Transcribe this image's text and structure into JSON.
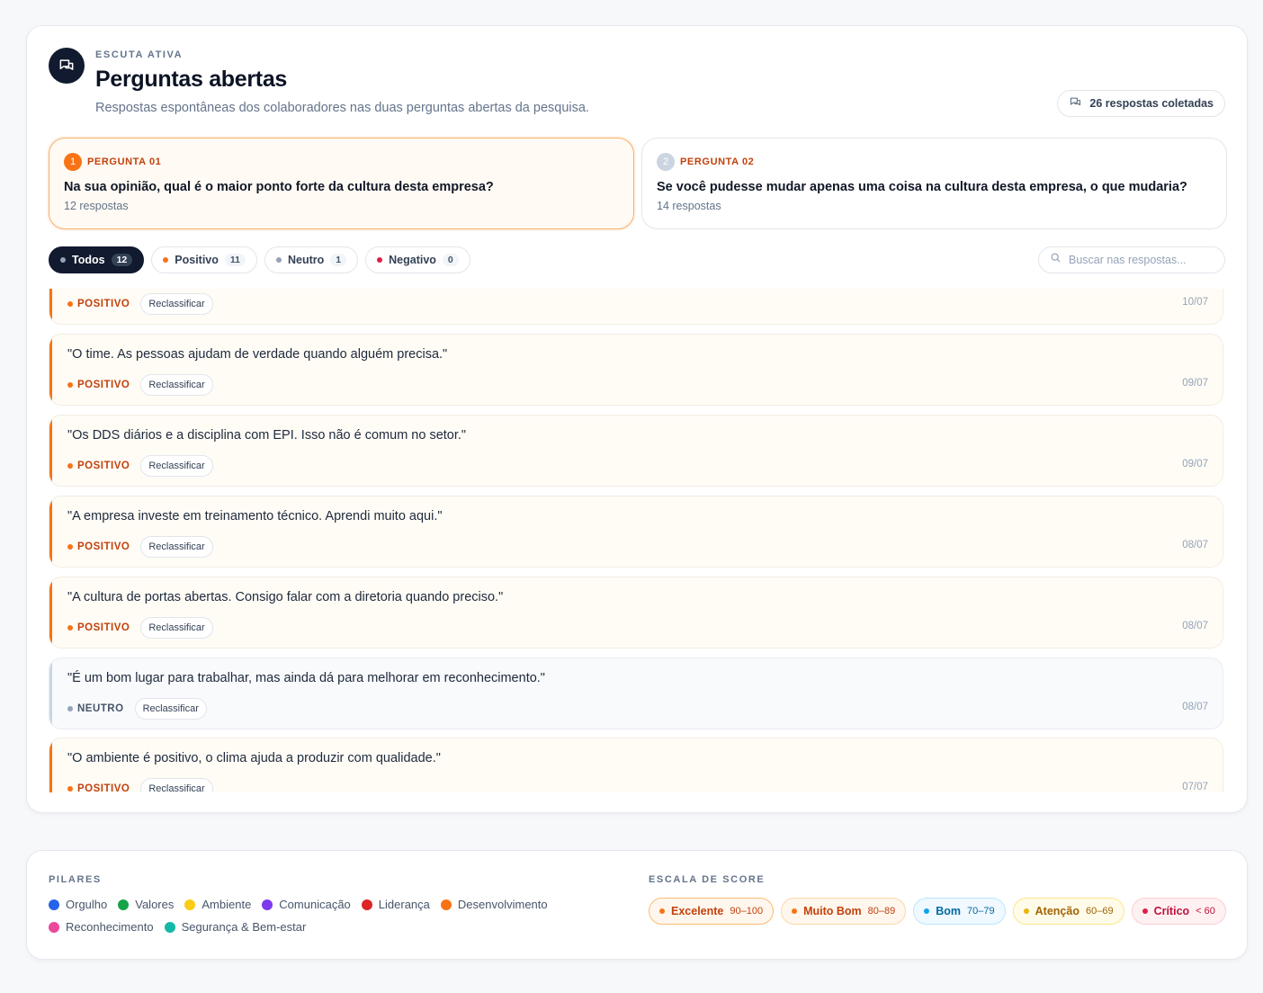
{
  "header": {
    "eyebrow": "ESCUTA ATIVA",
    "title": "Perguntas abertas",
    "subtitle": "Respostas espontâneas dos colaboradores nas duas perguntas abertas da pesquisa.",
    "responses_count": "26 respostas coletadas"
  },
  "questions": [
    {
      "num": "1",
      "label": "PERGUNTA 01",
      "text": "Na sua opinião, qual é o maior ponto forte da cultura desta empresa?",
      "count": "12 respostas"
    },
    {
      "num": "2",
      "label": "PERGUNTA 02",
      "text": "Se você pudesse mudar apenas uma coisa na cultura desta empresa, o que mudaria?",
      "count": "14 respostas"
    }
  ],
  "filters": [
    {
      "label": "Todos",
      "count": "12",
      "color": "#94a3b8"
    },
    {
      "label": "Positivo",
      "count": "11",
      "color": "#f97316"
    },
    {
      "label": "Neutro",
      "count": "1",
      "color": "#94a3b8"
    },
    {
      "label": "Negativo",
      "count": "0",
      "color": "#e11d48"
    }
  ],
  "search": {
    "placeholder": "Buscar nas respostas..."
  },
  "reclassify_label": "Reclassificar",
  "responses": [
    {
      "text": "",
      "sentiment": "POSITIVO",
      "date": "10/07"
    },
    {
      "text": "\"O time. As pessoas ajudam de verdade quando alguém precisa.\"",
      "sentiment": "POSITIVO",
      "date": "09/07"
    },
    {
      "text": "\"Os DDS diários e a disciplina com EPI. Isso não é comum no setor.\"",
      "sentiment": "POSITIVO",
      "date": "09/07"
    },
    {
      "text": "\"A empresa investe em treinamento técnico. Aprendi muito aqui.\"",
      "sentiment": "POSITIVO",
      "date": "08/07"
    },
    {
      "text": "\"A cultura de portas abertas. Consigo falar com a diretoria quando preciso.\"",
      "sentiment": "POSITIVO",
      "date": "08/07"
    },
    {
      "text": "\"É um bom lugar para trabalhar, mas ainda dá para melhorar em reconhecimento.\"",
      "sentiment": "NEUTRO",
      "date": "08/07"
    },
    {
      "text": "\"O ambiente é positivo, o clima ajuda a produzir com qualidade.\"",
      "sentiment": "POSITIVO",
      "date": "07/07"
    }
  ],
  "pillars": {
    "label": "PILARES",
    "items": [
      {
        "name": "Orgulho",
        "color": "#2563eb"
      },
      {
        "name": "Valores",
        "color": "#16a34a"
      },
      {
        "name": "Ambiente",
        "color": "#facc15"
      },
      {
        "name": "Comunicação",
        "color": "#7c3aed"
      },
      {
        "name": "Liderança",
        "color": "#dc2626"
      },
      {
        "name": "Desenvolvimento",
        "color": "#f97316"
      },
      {
        "name": "Reconhecimento",
        "color": "#ec4899"
      },
      {
        "name": "Segurança & Bem-estar",
        "color": "#14b8a6"
      }
    ]
  },
  "score_scale": {
    "label": "ESCALA DE SCORE",
    "items": [
      {
        "name": "Excelente",
        "range": "90–100",
        "color": "#f97316",
        "text": "#c2410c",
        "bg": "#fff7ed",
        "border": "#fdba74"
      },
      {
        "name": "Muito Bom",
        "range": "80–89",
        "color": "#f97316",
        "text": "#c2410c",
        "bg": "#fff7ed",
        "border": "#fed7aa"
      },
      {
        "name": "Bom",
        "range": "70–79",
        "color": "#0ea5e9",
        "text": "#0369a1",
        "bg": "#f0f9ff",
        "border": "#bae6fd"
      },
      {
        "name": "Atenção",
        "range": "60–69",
        "color": "#eab308",
        "text": "#a16207",
        "bg": "#fefce8",
        "border": "#fde68a"
      },
      {
        "name": "Crítico",
        "range": "< 60",
        "color": "#e11d48",
        "text": "#be123c",
        "bg": "#fff1f2",
        "border": "#fecdd3"
      }
    ]
  }
}
